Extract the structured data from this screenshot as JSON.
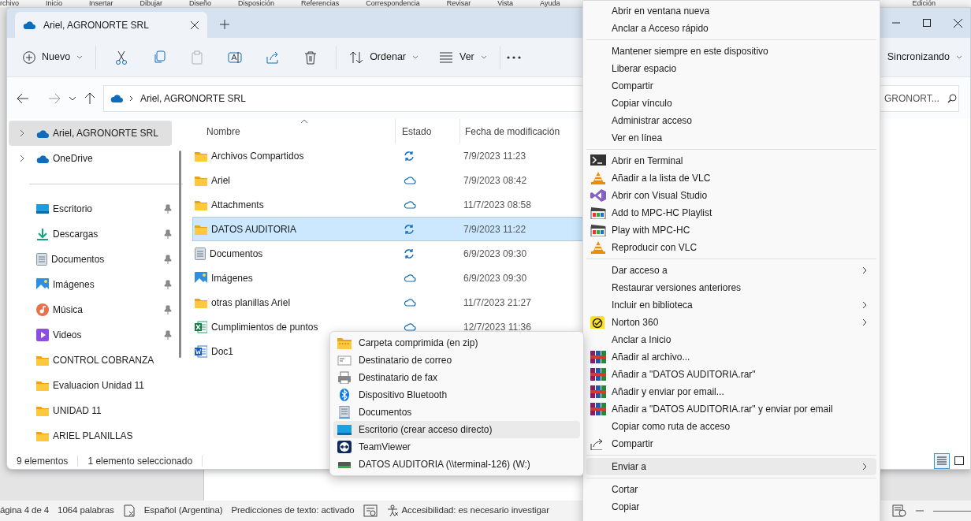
{
  "word": {
    "ribbon_tabs": [
      "rchivo",
      "Inicio",
      "Insertar",
      "Dibujar",
      "Diseño",
      "Disposición",
      "Referencias",
      "Correspondencia",
      "Revisar",
      "Vista",
      "Ayuda"
    ],
    "ribbon_right": "Edición",
    "status_bar": [
      {
        "kind": "text",
        "label": "ágina 4 de 4"
      },
      {
        "kind": "text",
        "label": "1064 palabras"
      },
      {
        "kind": "proofing"
      },
      {
        "kind": "text",
        "label": "Español (Argentina)"
      },
      {
        "kind": "text",
        "label": "Predicciones de texto: activado"
      },
      {
        "kind": "focus"
      },
      {
        "kind": "accessibility",
        "label": "Accesibilidad: es necesario investigar"
      }
    ]
  },
  "explorer": {
    "tab": {
      "title": "Ariel, AGRONORTE SRL"
    },
    "toolbar": {
      "new_button": {
        "label": "Nuevo"
      },
      "actions": [
        {
          "kind": "cut",
          "disabled": false
        },
        {
          "kind": "copy",
          "disabled": false
        },
        {
          "kind": "paste",
          "disabled": true
        },
        {
          "kind": "rename",
          "disabled": false
        },
        {
          "kind": "share",
          "disabled": false
        },
        {
          "kind": "delete",
          "disabled": false
        }
      ],
      "sort_button": {
        "label": "Ordenar"
      },
      "view_button": {
        "label": "Ver"
      },
      "sync_status": "Sincronizando"
    },
    "address": {
      "path": [
        "Ariel, AGRONORTE SRL"
      ]
    },
    "search": {
      "placeholder": "GRONORT..."
    },
    "sidebar": {
      "roots": [
        {
          "kind": "cloud",
          "label": "Ariel, AGRONORTE SRL",
          "selected": true
        },
        {
          "kind": "cloud",
          "label": "OneDrive",
          "selected": false
        }
      ],
      "quick_access": [
        {
          "kind": "desktop",
          "label": "Escritorio",
          "pinned": true,
          "selected": false
        },
        {
          "kind": "downloads",
          "label": "Descargas",
          "pinned": true,
          "selected": false
        },
        {
          "kind": "documents",
          "label": "Documentos",
          "pinned": true,
          "selected": false
        },
        {
          "kind": "pictures",
          "label": "Imágenes",
          "pinned": true,
          "selected": false
        },
        {
          "kind": "music",
          "label": "Música",
          "pinned": true,
          "selected": false
        },
        {
          "kind": "videos",
          "label": "Videos",
          "pinned": true,
          "selected": false
        },
        {
          "kind": "folder",
          "label": "CONTROL COBRANZA",
          "pinned": false,
          "selected": false
        },
        {
          "kind": "folder",
          "label": "Evaluacion Unidad 11",
          "pinned": false,
          "selected": false
        },
        {
          "kind": "folder",
          "label": "UNIDAD 11",
          "pinned": false,
          "selected": false
        },
        {
          "kind": "folder",
          "label": "ARIEL PLANILLAS",
          "pinned": false,
          "selected": false
        }
      ]
    },
    "columns": [
      {
        "label": "Nombre",
        "sorted": true
      },
      {
        "label": "Estado",
        "sorted": false
      },
      {
        "label": "Fecha de modificación",
        "sorted": false
      }
    ],
    "rows": [
      {
        "kind": "folder",
        "name": "Archivos Compartidos",
        "syncing": true,
        "date": "7/9/2023 11:23",
        "selected": false
      },
      {
        "kind": "folder",
        "name": "Ariel",
        "syncing": false,
        "date": "7/9/2023 08:42",
        "selected": false
      },
      {
        "kind": "folder",
        "name": "Attachments",
        "syncing": false,
        "date": "11/7/2023 08:58",
        "selected": false
      },
      {
        "kind": "folder",
        "name": "DATOS AUDITORIA",
        "syncing": true,
        "date": "7/9/2023 11:22",
        "selected": true
      },
      {
        "kind": "documents",
        "name": "Documentos",
        "syncing": true,
        "date": "6/9/2023 09:30",
        "selected": false
      },
      {
        "kind": "pictures",
        "name": "Imágenes",
        "syncing": false,
        "date": "6/9/2023 09:30",
        "selected": false
      },
      {
        "kind": "folder",
        "name": "otras planillas Ariel",
        "syncing": false,
        "date": "11/7/2023 21:27",
        "selected": false
      },
      {
        "kind": "excel",
        "name": "Cumplimientos de puntos",
        "syncing": false,
        "date": "12/7/2023 11:36",
        "selected": false
      },
      {
        "kind": "word",
        "name": "Doc1",
        "selected": false
      }
    ],
    "status_bar": {
      "count": "9 elementos",
      "selection": "1 elemento seleccionado"
    },
    "view_buttons": [
      {
        "kind": "details",
        "selected": true
      },
      {
        "kind": "tiles",
        "selected": false
      }
    ]
  },
  "context_menu": {
    "items": [
      {
        "kind": "plain",
        "label": "Abrir en ventana nueva",
        "submenu": false,
        "selected": false
      },
      {
        "kind": "plain",
        "label": "Anclar a Acceso rápido",
        "submenu": false,
        "selected": false
      },
      {
        "kind": "separator"
      },
      {
        "kind": "plain",
        "label": "Mantener siempre en este dispositivo",
        "submenu": false,
        "selected": false
      },
      {
        "kind": "plain",
        "label": "Liberar espacio",
        "submenu": false,
        "selected": false
      },
      {
        "kind": "plain",
        "label": "Compartir",
        "submenu": false,
        "selected": false
      },
      {
        "kind": "plain",
        "label": "Copiar vínculo",
        "submenu": false,
        "selected": false
      },
      {
        "kind": "plain",
        "label": "Administrar acceso",
        "submenu": false,
        "selected": false
      },
      {
        "kind": "plain",
        "label": "Ver en línea",
        "submenu": false,
        "selected": false
      },
      {
        "kind": "separator"
      },
      {
        "kind": "terminal",
        "label": "Abrir en Terminal",
        "submenu": false,
        "selected": false
      },
      {
        "kind": "cone",
        "label": "Añadir a la lista de VLC",
        "submenu": false,
        "selected": false
      },
      {
        "kind": "studio",
        "label": "Abrir con Visual Studio",
        "submenu": false,
        "selected": false
      },
      {
        "kind": "clapper",
        "label": "Add to MPC-HC Playlist",
        "submenu": false,
        "selected": false
      },
      {
        "kind": "clapper",
        "label": "Play with MPC-HC",
        "submenu": false,
        "selected": false
      },
      {
        "kind": "cone",
        "label": "Reproducir con VLC",
        "submenu": false,
        "selected": false
      },
      {
        "kind": "separator"
      },
      {
        "kind": "plain",
        "label": "Dar acceso a",
        "submenu": true,
        "selected": false
      },
      {
        "kind": "plain",
        "label": "Restaurar versiones anteriores",
        "submenu": false,
        "selected": false
      },
      {
        "kind": "plain",
        "label": "Incluir en biblioteca",
        "submenu": true,
        "selected": false
      },
      {
        "kind": "check",
        "label": "Norton 360",
        "submenu": true,
        "selected": false
      },
      {
        "kind": "plain",
        "label": "Anclar a Inicio",
        "submenu": false,
        "selected": false
      },
      {
        "kind": "books",
        "label": "Añadir al archivo...",
        "submenu": false,
        "selected": false
      },
      {
        "kind": "books",
        "label": "Añadir a \"DATOS AUDITORIA.rar\"",
        "submenu": false,
        "selected": false
      },
      {
        "kind": "books",
        "label": "Añadir y enviar por email...",
        "submenu": false,
        "selected": false
      },
      {
        "kind": "books",
        "label": "Añadir a \"DATOS AUDITORIA.rar\" y enviar por email",
        "submenu": false,
        "selected": false
      },
      {
        "kind": "plain",
        "label": "Copiar como ruta de acceso",
        "submenu": false,
        "selected": false
      },
      {
        "kind": "share",
        "label": "Compartir",
        "submenu": false,
        "selected": false
      },
      {
        "kind": "separator"
      },
      {
        "kind": "plain",
        "label": "Enviar a",
        "submenu": true,
        "selected": true
      },
      {
        "kind": "separator"
      },
      {
        "kind": "plain",
        "label": "Cortar",
        "submenu": false,
        "selected": false
      },
      {
        "kind": "plain",
        "label": "Copiar",
        "submenu": false,
        "selected": false
      }
    ]
  },
  "send_to_menu": {
    "items": [
      {
        "kind": "zip",
        "label": "Carpeta comprimida (en zip)",
        "selected": false
      },
      {
        "kind": "mail",
        "label": "Destinatario de correo",
        "selected": false
      },
      {
        "kind": "fax",
        "label": "Destinatario de fax",
        "selected": false
      },
      {
        "kind": "bluetooth",
        "label": "Dispositivo Bluetooth",
        "selected": false
      },
      {
        "kind": "documents",
        "label": "Documentos",
        "selected": false
      },
      {
        "kind": "desktop",
        "label": "Escritorio (crear acceso directo)",
        "selected": true
      },
      {
        "kind": "remote",
        "label": "TeamViewer",
        "selected": false
      },
      {
        "kind": "drive",
        "label": "DATOS AUDITORIA (\\\\terminal-126) (W:)",
        "selected": false
      }
    ]
  }
}
